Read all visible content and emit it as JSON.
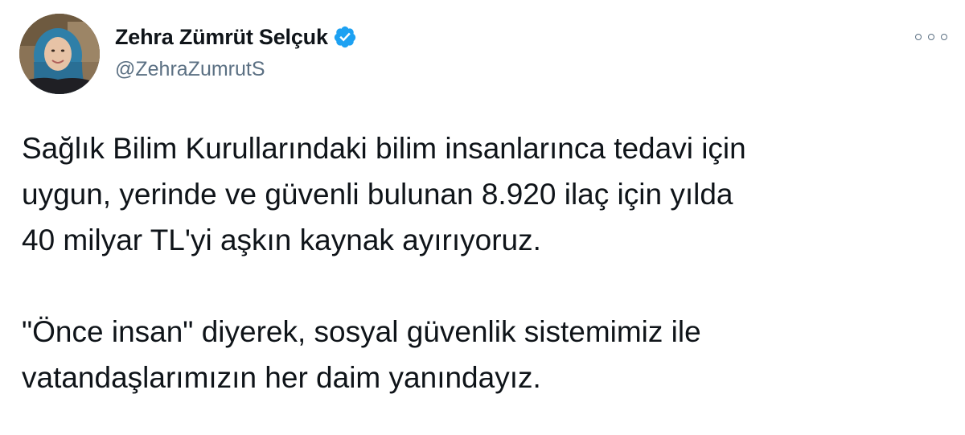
{
  "author": {
    "display_name": "Zehra Zümrüt Selçuk",
    "handle": "@ZehraZumrutS",
    "verified": true
  },
  "icons": {
    "avatar": "user-avatar-photo",
    "verified": "verified-badge-icon",
    "more": "more-options-icon"
  },
  "colors": {
    "text_primary": "#0f1419",
    "text_secondary": "#5b7083",
    "verified_blue": "#1da1f2"
  },
  "tweet": {
    "paragraph1": [
      "Sağlık Bilim Kurullarındaki bilim insanlarınca tedavi için",
      "uygun, yerinde ve güvenli bulunan 8.920 ilaç için yılda",
      "40 milyar TL'yi aşkın kaynak ayırıyoruz."
    ],
    "paragraph2": [
      "\"Önce insan\" diyerek, sosyal güvenlik sistemimiz ile",
      "vatandaşlarımızın her daim yanındayız."
    ]
  }
}
